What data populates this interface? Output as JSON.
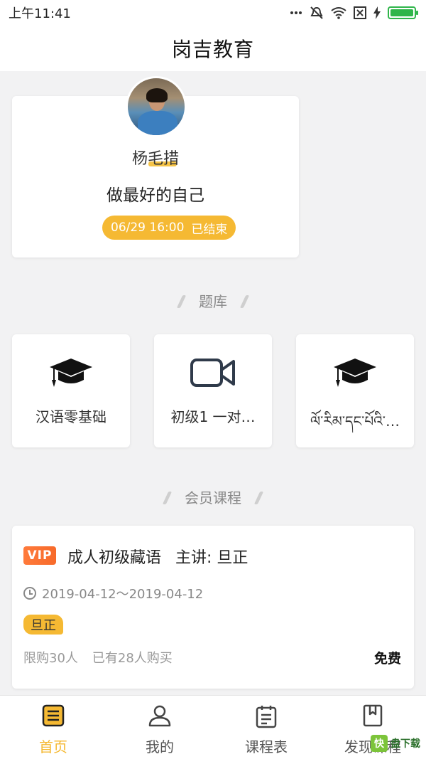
{
  "status_bar": {
    "time": "上午11:41",
    "battery_level": 1.0,
    "icons": [
      "more-dots-icon",
      "mute-icon",
      "wifi-icon",
      "sim-off-icon",
      "charging-icon",
      "battery-icon"
    ]
  },
  "header": {
    "title": "岗吉教育"
  },
  "teacher": {
    "name": "杨毛措",
    "motto": "做最好的自己",
    "live_time": "06/29 16:00",
    "live_status": "已结束"
  },
  "question_bank": {
    "title": "题库",
    "items": [
      {
        "label": "汉语零基础",
        "icon": "graduation-cap-icon"
      },
      {
        "label": "初级1 一对…",
        "icon": "video-camera-icon"
      },
      {
        "label": "ལོ་རིམ་དང་པོའི་…",
        "icon": "graduation-cap-icon"
      }
    ]
  },
  "member_courses": {
    "title": "会员课程",
    "items": [
      {
        "badge": "VIP",
        "name": "成人初级藏语",
        "lecturer": "主讲: 旦正",
        "date_range": "2019-04-12～2019-04-12",
        "teacher_tag": "旦正",
        "limit": "限购30人",
        "sold": "已有28人购买",
        "price": "免费"
      }
    ]
  },
  "bottom_nav": {
    "items": [
      {
        "label": "首页",
        "icon": "home-list-icon",
        "active": true
      },
      {
        "label": "我的",
        "icon": "user-icon",
        "active": false
      },
      {
        "label": "课程表",
        "icon": "schedule-icon",
        "active": false
      },
      {
        "label": "发现课程",
        "icon": "book-icon",
        "active": false
      }
    ]
  },
  "watermark": {
    "logo": "快",
    "text": "盘下载"
  },
  "colors": {
    "accent": "#f5b933",
    "vip": "#f76a2a",
    "background": "#f2f2f3"
  }
}
